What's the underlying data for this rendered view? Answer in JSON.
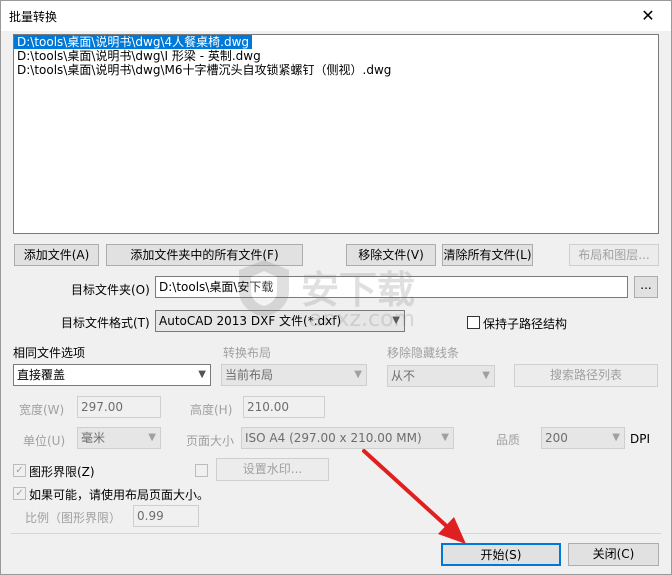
{
  "window": {
    "title": "批量转换",
    "close_glyph": "✕"
  },
  "file_list": [
    "D:\\tools\\桌面\\说明书\\dwg\\4人餐桌椅.dwg",
    "D:\\tools\\桌面\\说明书\\dwg\\I 形梁 - 英制.dwg",
    "D:\\tools\\桌面\\说明书\\dwg\\M6十字槽沉头自攻锁紧螺钉（侧视）.dwg"
  ],
  "buttons": {
    "add_file": "添加文件(A)",
    "add_folder": "添加文件夹中的所有文件(F)",
    "remove_file": "移除文件(V)",
    "clear_all": "清除所有文件(L)",
    "layout_layers": "布局和图层...",
    "browse": "...",
    "search_paths": "搜索路径列表",
    "watermark": "设置水印...",
    "start": "开始(S)",
    "close": "关闭(C)"
  },
  "target_folder": {
    "label": "目标文件夹(O)",
    "value": "D:\\tools\\桌面\\安下载"
  },
  "target_format": {
    "label": "目标文件格式(T)",
    "value": "AutoCAD 2013 DXF 文件(*.dxf)"
  },
  "keep_subpath": {
    "label": "保持子路径结构",
    "checked": false
  },
  "same_file_option": {
    "label": "相同文件选项",
    "value": "直接覆盖"
  },
  "convert_layout": {
    "label": "转换布局",
    "value": "当前布局"
  },
  "hidden_lines": {
    "label": "移除隐藏线条",
    "value": "从不"
  },
  "width": {
    "label": "宽度(W)",
    "value": "297.00"
  },
  "height": {
    "label": "高度(H)",
    "value": "210.00"
  },
  "unit": {
    "label": "单位(U)",
    "value": "毫米"
  },
  "page_size": {
    "label": "页面大小",
    "value": "ISO A4 (297.00 x 210.00 MM)"
  },
  "quality": {
    "label": "品质",
    "value": "200",
    "unit": "DPI"
  },
  "graphic_limits": {
    "label": "图形界限(Z)",
    "checked": true
  },
  "use_layout_size": {
    "label": "如果可能，请使用布局页面大小。",
    "checked": true
  },
  "ratio": {
    "label": "比例（图形界限）",
    "value": "0.99"
  },
  "watermark_checkbox": {
    "checked": false
  },
  "site_watermark": {
    "text": "安下载",
    "sub": "anxz.com"
  },
  "colors": {
    "selection": "#0078d7",
    "arrow": "#e02020"
  }
}
